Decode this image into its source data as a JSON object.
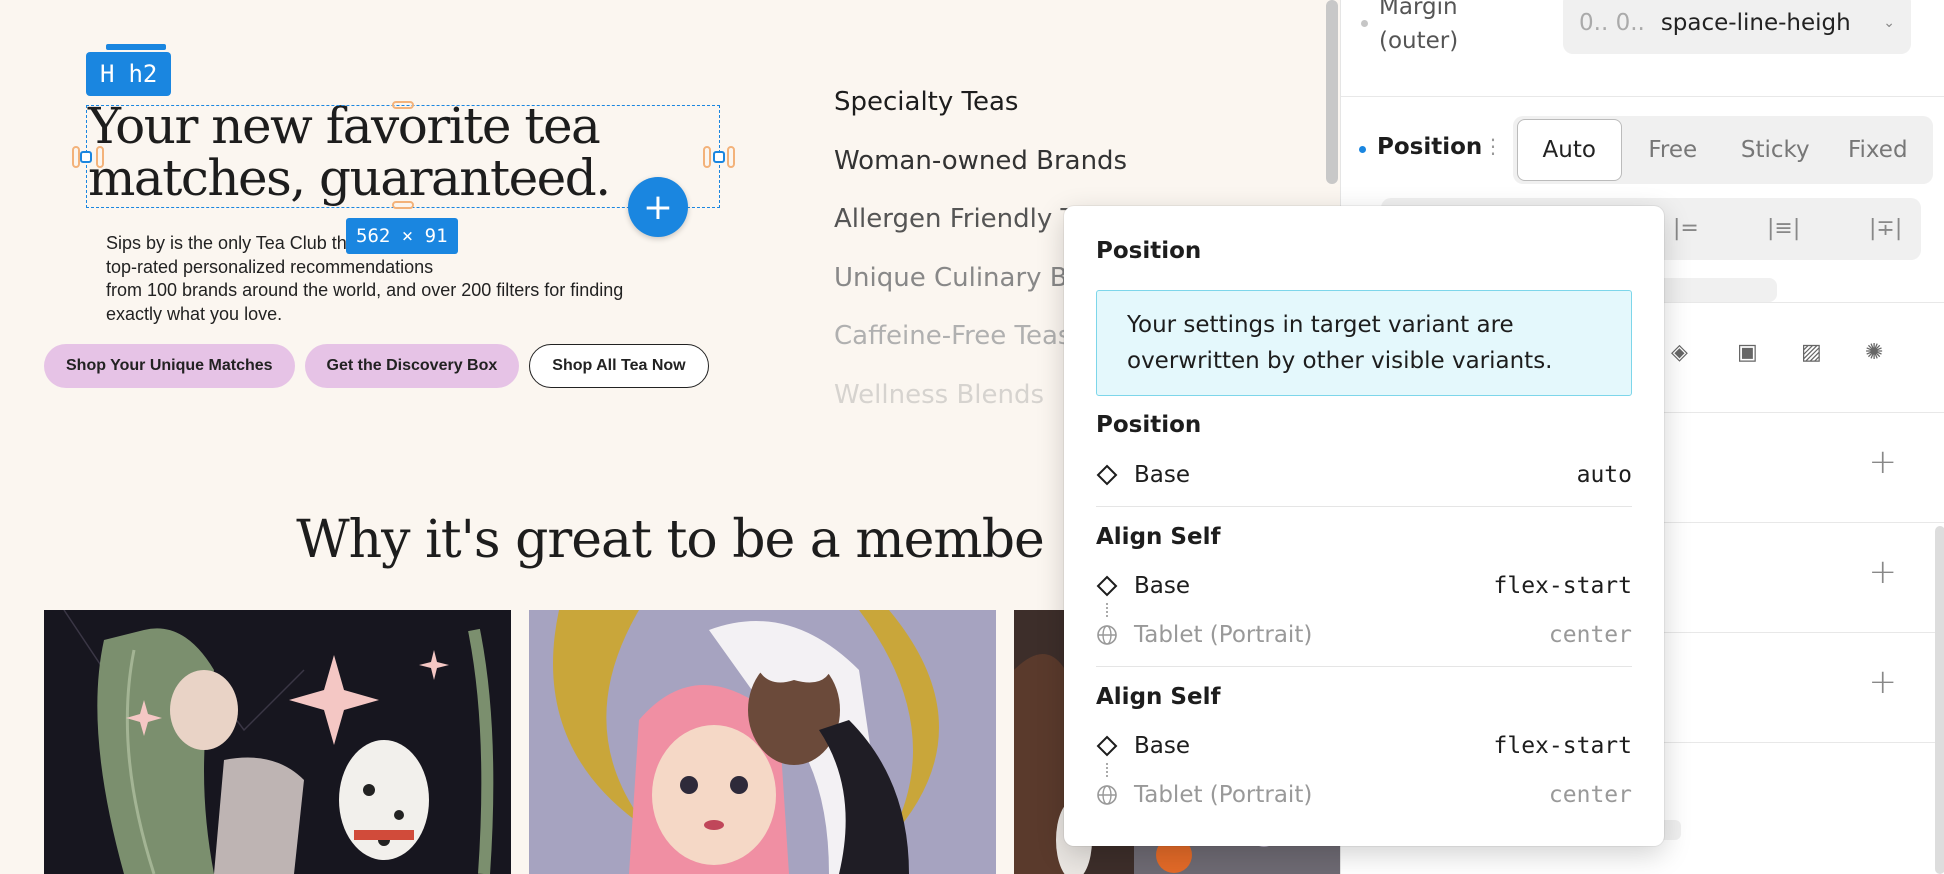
{
  "canvas": {
    "element_tag": {
      "icon": "H",
      "label": "h2"
    },
    "heading": "Your new favorite tea matches, guaranteed.",
    "dimensions": "562 × 91",
    "subtext": "Sips by is the only Tea Club that offers top-rated personalized recommendations from 100 brands around the world, and over 200 filters for finding exactly what you love.",
    "subtext_lines": [
      "Sips by is the only Tea Club th",
      "top-rated personalized recommendations",
      "from 100 brands around the world, and over 200 filters for finding",
      "exactly what you love."
    ],
    "buttons": [
      "Shop Your Unique Matches",
      "Get the Discovery Box",
      "Shop All Tea Now"
    ],
    "categories": [
      "Specialty Teas",
      "Woman-owned Brands",
      "Allergen Friendly T",
      "Unique Culinary B",
      "Caffeine-Free Teas",
      "Wellness Blends"
    ],
    "section_title": "Why it's great to be a membe"
  },
  "panel": {
    "margin_label": "Margin (outer)",
    "margin_label_l1": "Margin",
    "margin_label_l2": "(outer)",
    "margin_placeholder": "0.. 0..",
    "margin_value": "space-line-heigh",
    "position_label": "Position",
    "position_options": [
      "Auto",
      "Free",
      "Sticky",
      "Fixed"
    ],
    "position_selected": "Auto",
    "accent": "#1a86e0"
  },
  "popover": {
    "title": "Position",
    "info": "Your settings in target variant are overwritten by other visible variants.",
    "groups": [
      {
        "title": "Position",
        "rows": [
          {
            "name": "Base",
            "value": "auto",
            "icon": "diamond-icon"
          }
        ]
      },
      {
        "title": "Align Self",
        "rows": [
          {
            "name": "Base",
            "value": "flex-start",
            "icon": "diamond-icon"
          },
          {
            "name": "Tablet (Portrait)",
            "value": "center",
            "icon": "globe-icon"
          }
        ]
      },
      {
        "title": "Align Self",
        "rows": [
          {
            "name": "Base",
            "value": "flex-start",
            "icon": "diamond-icon"
          },
          {
            "name": "Tablet (Portrait)",
            "value": "center",
            "icon": "globe-icon"
          }
        ]
      }
    ]
  }
}
